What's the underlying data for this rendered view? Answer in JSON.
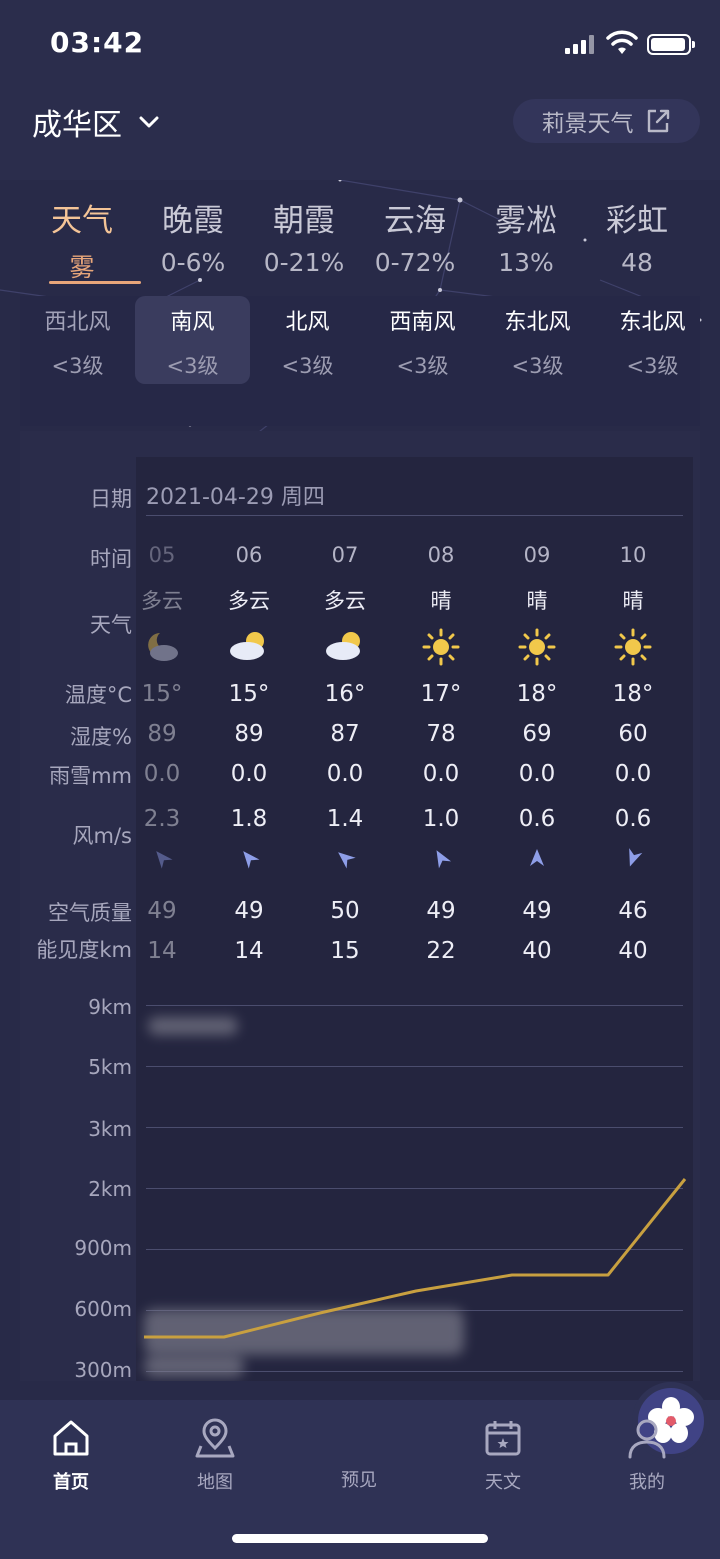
{
  "status": {
    "time": "03:42"
  },
  "header": {
    "location": "成华区",
    "brand_label": "莉景天气"
  },
  "category_tabs": [
    {
      "label": "天气",
      "value": "雾",
      "active": true
    },
    {
      "label": "晚霞",
      "value": "0-6%"
    },
    {
      "label": "朝霞",
      "value": "0-21%"
    },
    {
      "label": "云海",
      "value": "0-72%"
    },
    {
      "label": "雾凇",
      "value": "13%"
    },
    {
      "label": "彩虹",
      "value": "48"
    }
  ],
  "wind_items": [
    {
      "dir": "西北风",
      "level": "<3级"
    },
    {
      "dir": "南风",
      "level": "<3级",
      "selected": true
    },
    {
      "dir": "北风",
      "level": "<3级"
    },
    {
      "dir": "西南风",
      "level": "<3级"
    },
    {
      "dir": "东北风",
      "level": "<3级"
    },
    {
      "dir": "东北风",
      "level": "<3级"
    }
  ],
  "table": {
    "row_labels": {
      "date": "日期",
      "time": "时间",
      "weather": "天气",
      "temp": "温度°C",
      "humidity": "湿度%",
      "precip": "雨雪mm",
      "wind": "风m/s",
      "aqi": "空气质量",
      "visibility": "能见度km"
    },
    "date_value": "2021-04-29 周四",
    "hours": [
      {
        "time": "05",
        "cond": "多云",
        "icon": "cloudy-night-icon",
        "temp": "15°",
        "humidity": "89",
        "precip": "0.0",
        "wind": "2.3",
        "aqi": "49",
        "vis": "14",
        "partial": true
      },
      {
        "time": "06",
        "cond": "多云",
        "icon": "partly-cloudy-icon",
        "temp": "15°",
        "humidity": "89",
        "precip": "0.0",
        "wind": "1.8",
        "aqi": "49",
        "vis": "14"
      },
      {
        "time": "07",
        "cond": "多云",
        "icon": "partly-cloudy-icon",
        "temp": "16°",
        "humidity": "87",
        "precip": "0.0",
        "wind": "1.4",
        "aqi": "50",
        "vis": "15"
      },
      {
        "time": "08",
        "cond": "晴",
        "icon": "sun-icon",
        "temp": "17°",
        "humidity": "78",
        "precip": "0.0",
        "wind": "1.0",
        "aqi": "49",
        "vis": "22"
      },
      {
        "time": "09",
        "cond": "晴",
        "icon": "sun-icon",
        "temp": "18°",
        "humidity": "69",
        "precip": "0.0",
        "wind": "0.6",
        "aqi": "49",
        "vis": "40"
      },
      {
        "time": "10",
        "cond": "晴",
        "icon": "sun-icon",
        "temp": "18°",
        "humidity": "60",
        "precip": "0.0",
        "wind": "0.6",
        "aqi": "46",
        "vis": "40"
      }
    ],
    "altitude_labels": [
      "9km",
      "5km",
      "3km",
      "2km",
      "900m",
      "600m",
      "300m"
    ]
  },
  "colors": {
    "accent": "#e8a67a",
    "line": "#c8a040",
    "arrow": "#8e9ee8"
  },
  "nav": [
    {
      "label": "首页",
      "icon": "home-icon",
      "active": true
    },
    {
      "label": "地图",
      "icon": "map-pin-icon"
    },
    {
      "label": "预见",
      "icon": "flower-icon"
    },
    {
      "label": "天文",
      "icon": "calendar-icon"
    },
    {
      "label": "我的",
      "icon": "user-icon"
    }
  ]
}
